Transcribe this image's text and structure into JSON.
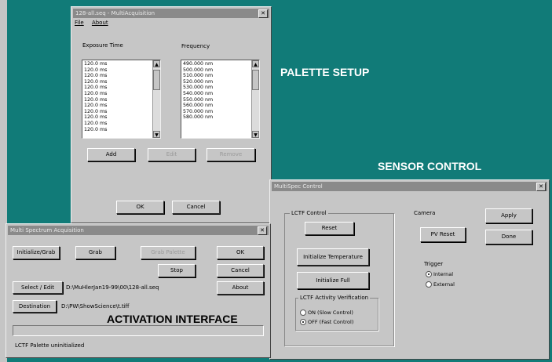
{
  "labels": {
    "palette_setup": "PALETTE SETUP",
    "sensor_control": "SENSOR CONTROL",
    "activation_interface": "ACTIVATION INTERFACE"
  },
  "palette_window": {
    "title": "128-all.seq - MultiAcquisition",
    "menu": [
      "File",
      "About"
    ],
    "exposure_header": "Exposure Time",
    "frequency_header": "Frequency",
    "exposure_items": [
      "120.0 ms",
      "120.0 ms",
      "120.0 ms",
      "120.0 ms",
      "120.0 ms",
      "120.0 ms",
      "120.0 ms",
      "120.0 ms",
      "120.0 ms",
      "120.0 ms",
      "120.0 ms",
      "120.0 ms"
    ],
    "frequency_items": [
      "490.000 nm",
      "500.000 nm",
      "510.000 nm",
      "520.000 nm",
      "530.000 nm",
      "540.000 nm",
      "550.000 nm",
      "560.000 nm",
      "570.000 nm",
      "580.000 nm"
    ],
    "add_label": "Add",
    "edit_label": "Edit",
    "remove_label": "Remove",
    "ok_label": "OK",
    "cancel_label": "Cancel"
  },
  "acquisition_window": {
    "title": "Multi Spectrum Acquisition",
    "initialize_grab": "Initialize/Grab",
    "grab": "Grab",
    "grab_palette": "Grab Palette",
    "ok": "OK",
    "stop": "Stop",
    "cancel": "Cancel",
    "select_edit": "Select / Edit",
    "palette_path": "D:\\MuHlerJan19-99\\00\\128-all.seq",
    "about": "About",
    "destination": "Destination",
    "destination_path": "D:\\PW\\ShowScience\\t.tiff",
    "status": "LCTF Palette uninitialized"
  },
  "sensor_window": {
    "title": "MultiSpec Control",
    "lctf_group": "LCTF Control",
    "reset": "Reset",
    "init_temp": "Initialize Temperature",
    "init_full": "Initialize Full",
    "verify_group": "LCTF Activity Verification",
    "verify_on": "ON (Slow Control)",
    "verify_off": "OFF (Fast Control)",
    "camera_label": "Camera",
    "pv_reset": "PV Reset",
    "apply": "Apply",
    "done": "Done",
    "trigger_label": "Trigger",
    "trigger_internal": "Internal",
    "trigger_external": "External"
  }
}
